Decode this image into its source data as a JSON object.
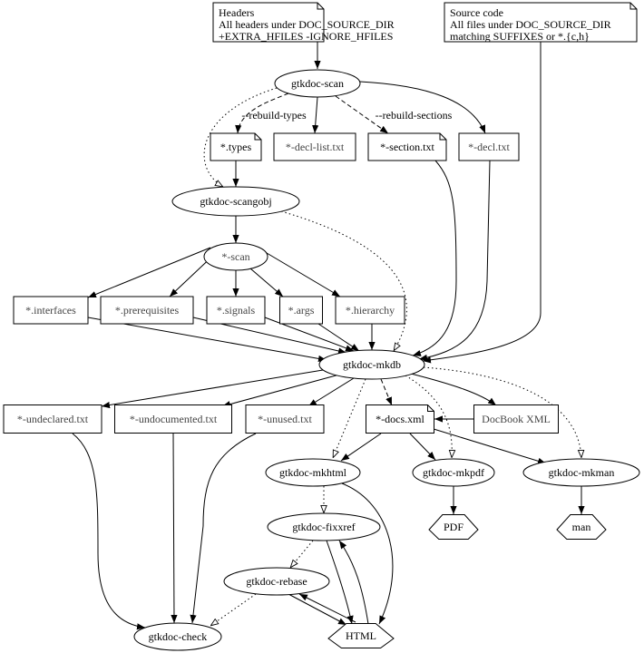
{
  "nodes": {
    "headers": {
      "lines": [
        "Headers",
        "All headers under DOC_SOURCE_DIR",
        "+EXTRA_HFILES -IGNORE_HFILES"
      ]
    },
    "source": {
      "lines": [
        "Source code",
        "All files under DOC_SOURCE_DIR",
        "matching SUFFIXES or *.{c,h}"
      ]
    },
    "scan": "gtkdoc-scan",
    "types": "*.types",
    "decl_list": "*-decl-list.txt",
    "section": "*-section.txt",
    "decl": "*-decl.txt",
    "scangobj": "gtkdoc-scangobj",
    "scan_prog": "*-scan",
    "interfaces": "*.interfaces",
    "prerequisites": "*.prerequisites",
    "signals": "*.signals",
    "args": "*.args",
    "hierarchy": "*.hierarchy",
    "mkdb": "gtkdoc-mkdb",
    "undeclared": "*-undeclared.txt",
    "undocumented": "*-undocumented.txt",
    "unused": "*-unused.txt",
    "docs": "*-docs.xml",
    "docbook": "DocBook XML",
    "mkhtml": "gtkdoc-mkhtml",
    "mkpdf": "gtkdoc-mkpdf",
    "mkman": "gtkdoc-mkman",
    "pdf": "PDF",
    "man": "man",
    "fixxref": "gtkdoc-fixxref",
    "rebase": "gtkdoc-rebase",
    "check": "gtkdoc-check",
    "html": "HTML"
  },
  "edge_labels": {
    "rebuild_types": "--rebuild-types",
    "rebuild_sections": "--rebuild-sections"
  },
  "edge_styles": {
    "solid": "normal arrow",
    "dashed": "optional (flag)",
    "dotted": "empty arrow"
  }
}
